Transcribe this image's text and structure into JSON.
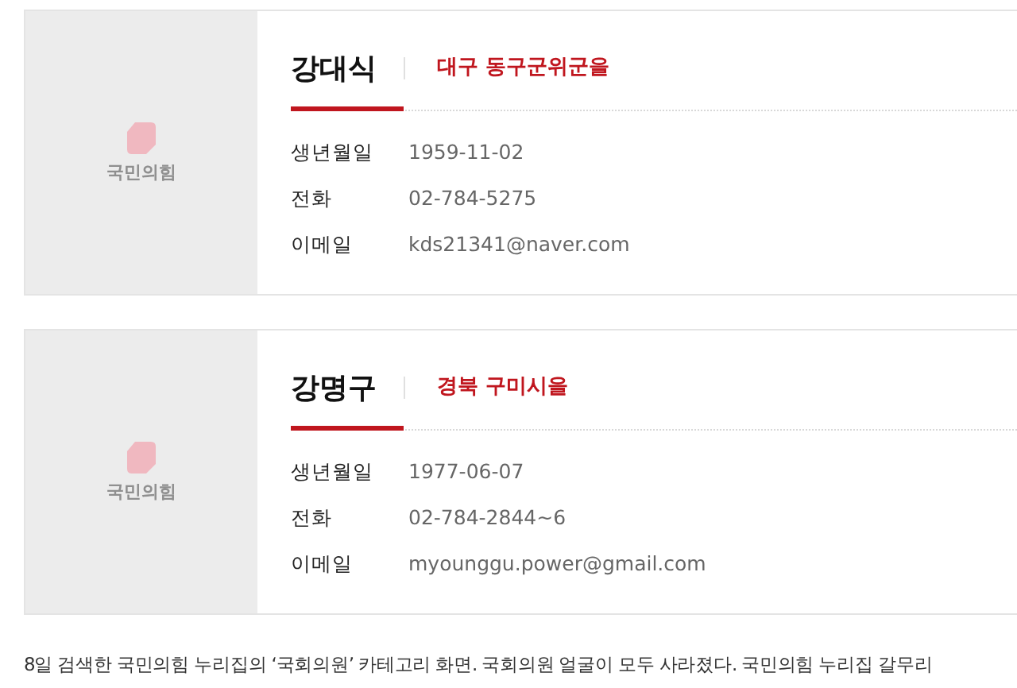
{
  "members": [
    {
      "logo_text": "국민의힘",
      "name": "강대식",
      "district": "대구 동구군위군을",
      "fields": [
        {
          "label": "생년월일",
          "value": "1959-11-02"
        },
        {
          "label": "전화",
          "value": "02-784-5275"
        },
        {
          "label": "이메일",
          "value": "kds21341@naver.com"
        }
      ]
    },
    {
      "logo_text": "국민의힘",
      "name": "강명구",
      "district": "경북 구미시을",
      "fields": [
        {
          "label": "생년월일",
          "value": "1977-06-07"
        },
        {
          "label": "전화",
          "value": "02-784-2844~6"
        },
        {
          "label": "이메일",
          "value": "myounggu.power@gmail.com"
        }
      ]
    }
  ],
  "caption": "8일 검색한 국민의힘 누리집의 ‘국회의원’ 카테고리 화면. 국회의원 얼굴이 모두 사라졌다. 국민의힘 누리집 갈무리"
}
